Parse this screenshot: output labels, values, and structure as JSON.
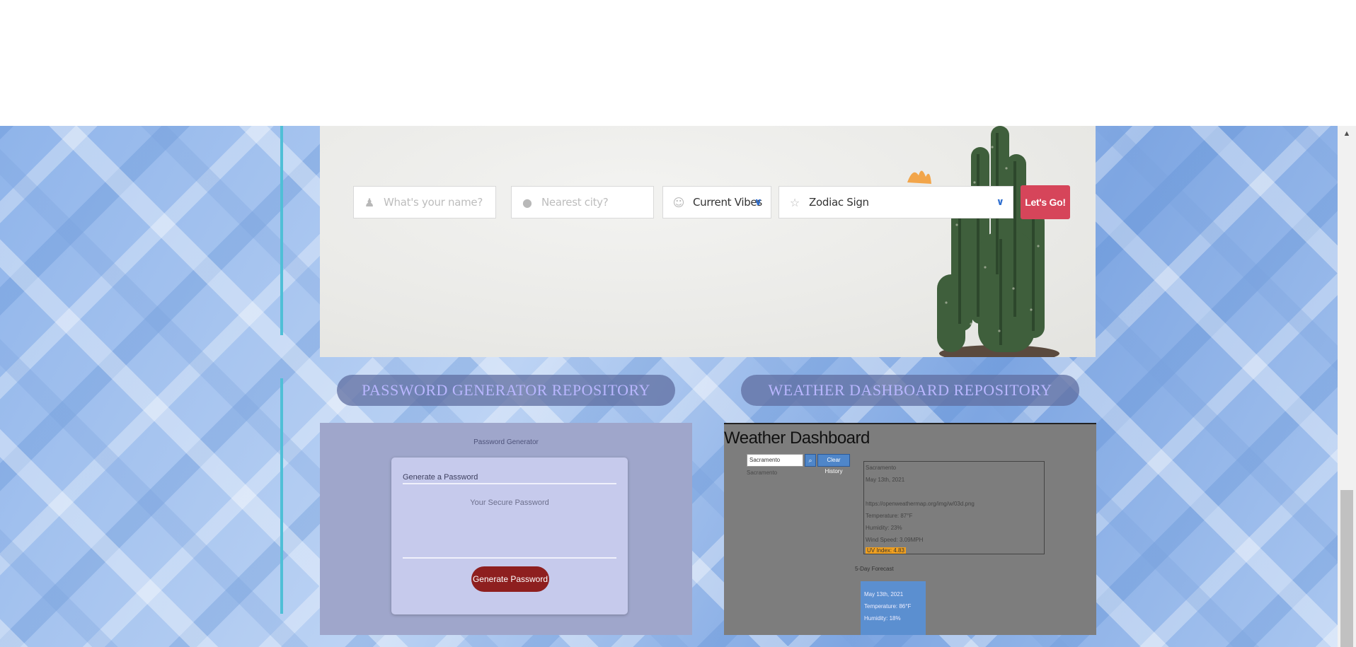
{
  "form": {
    "name_placeholder": "What's your name?",
    "city_placeholder": "Nearest city?",
    "vibes_value": "Current Vibes",
    "zodiac_value": "Zodiac Sign",
    "submit_label": "Let's Go!",
    "icons": [
      "person-icon",
      "globe-icon",
      "smiley-icon",
      "star-icon",
      "chevron-down-icon"
    ],
    "accent_color": "#d6455a"
  },
  "repositories": [
    {
      "label": "PASSWORD GENERATOR REPOSITORY"
    },
    {
      "label": "WEATHER DASHBOARD REPOSITORY"
    }
  ],
  "password_preview": {
    "header": "Password Generator",
    "card_title": "Generate a Password",
    "output_placeholder": "Your Secure Password",
    "button_label": "Generate Password"
  },
  "weather_preview": {
    "title": "Weather Dashboard",
    "search_value": "Sacramento",
    "clear_label": "Clear History",
    "history_item": "Sacramento",
    "current": {
      "city": "Sacramento",
      "date": "May 13th, 2021",
      "icon_url": "https://openweathermap.org/img/w/03d.png",
      "temperature": "Temperature: 87°F",
      "humidity": "Humidity: 23%",
      "wind": "Wind Speed: 3.09MPH",
      "uv": "UV Index: 4.83"
    },
    "forecast_title": "5-Day Forecast",
    "forecast": {
      "date": "May 13th, 2021",
      "temperature": "Temperature: 86°F",
      "humidity": "Humidity: 18%"
    }
  }
}
